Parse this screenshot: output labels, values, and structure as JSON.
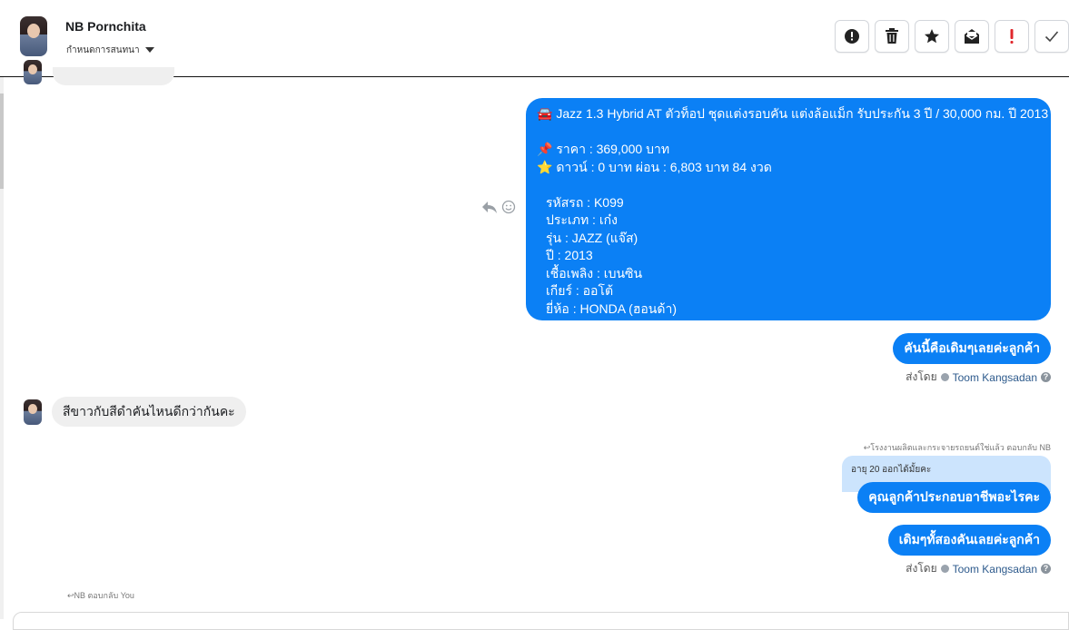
{
  "header": {
    "contact_name": "NB Pornchita",
    "status_label": "กำหนดการสนทนา",
    "toolbar": [
      {
        "name": "alert-circle-button",
        "icon": "alert-circle-icon"
      },
      {
        "name": "delete-button",
        "icon": "trash-icon"
      },
      {
        "name": "star-button",
        "icon": "star-icon"
      },
      {
        "name": "mark-unread-button",
        "icon": "envelope-open-icon"
      },
      {
        "name": "important-button",
        "icon": "exclamation-icon"
      },
      {
        "name": "done-button",
        "icon": "check-icon"
      }
    ]
  },
  "messages": {
    "car_listing": {
      "lines": [
        "🚘 Jazz 1.3 Hybrid AT ตัวท็อป ชุดแต่งรอบคัน แต่งล้อแม็ก รับประกัน 3 ปี / 30,000 กม. ปี 2013",
        "",
        "📌 ราคา : 369,000 บาท",
        "⭐ ดาวน์ : 0 บาท ผ่อน : 6,803 บาท 84 งวด",
        "",
        "รหัสรถ : K099",
        "ประเภท : เก๋ง",
        "รุ่น : JAZZ (แจ๊ส)",
        "ปี : 2013",
        "เชื้อเพลิง : เบนซิน",
        "เกียร์ : ออโต้",
        "ยี่ห้อ : HONDA (ฮอนด้า)"
      ]
    },
    "out_1": "คันนี้คือเดิมๆเลยค่ะลูกค้า",
    "sent_by_label": "ส่งโดย",
    "agent_name": "Toom Kangsadan",
    "in_1": "สีขาวกับสีดำคันไหนดีกว่ากันคะ",
    "reply_note_1": "โรงงานผลิตและกระจายรถยนต์ใช่แล้ว ตอบกลับ NB",
    "quoted_text": "อายุ 20 ออกได้มั้ยคะ",
    "out_2": "คุณลูกค้าประกอบอาชีพอะไรคะ",
    "out_3": "เดิมๆทั้สองคันเลยค่ะลูกค้า",
    "reply_note_2": "NB ตอบกลับ You"
  },
  "colors": {
    "outgoing_bubble": "#0b80f5",
    "incoming_bubble": "#efefef",
    "quoted_bubble": "#cce4fd",
    "important_red": "#e0272c"
  }
}
